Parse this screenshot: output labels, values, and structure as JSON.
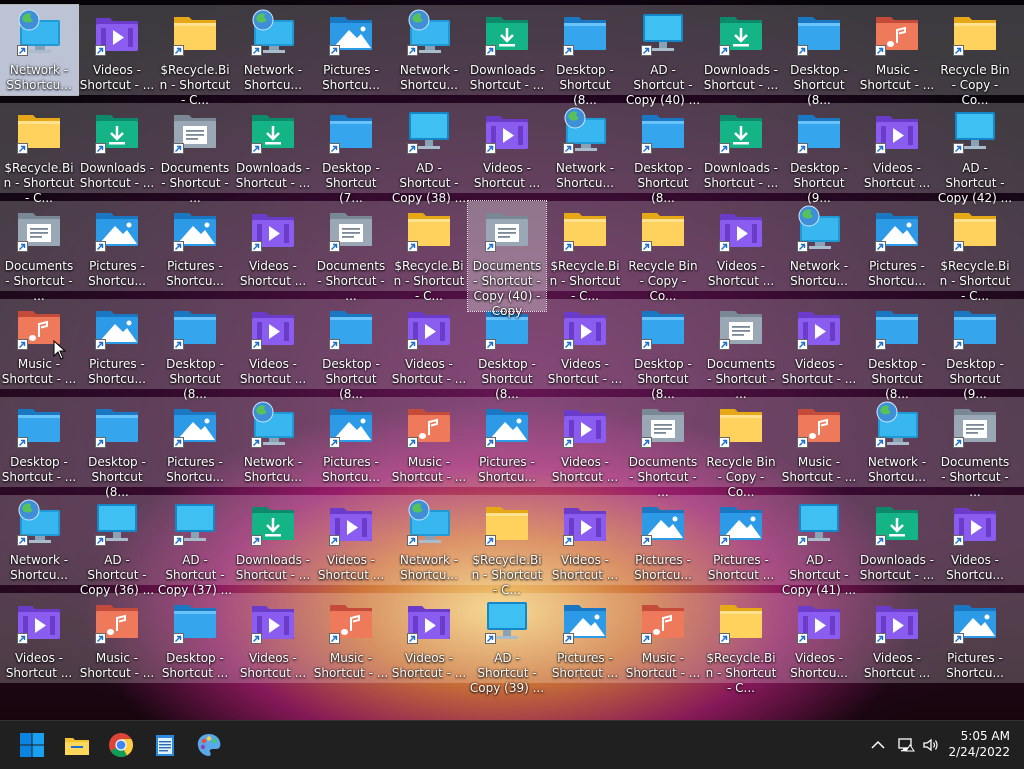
{
  "desktop": {
    "rows": [
      [
        {
          "label": "Network - SShortcu...",
          "icon": "network"
        },
        {
          "label": "Videos - Shortcut - ...",
          "icon": "videos"
        },
        {
          "label": "$Recycle.Bin - Shortcut - C...",
          "icon": "folder"
        },
        {
          "label": "Network - Shortcu...",
          "icon": "network"
        },
        {
          "label": "Pictures - Shortcu...",
          "icon": "pictures"
        },
        {
          "label": "Network - Shortcu...",
          "icon": "network"
        },
        {
          "label": "Downloads - Shortcut - ...",
          "icon": "downloads"
        },
        {
          "label": "Desktop - Shortcut (8...",
          "icon": "desktop"
        },
        {
          "label": "AD - Shortcut - Copy (40) ...",
          "icon": "monitor"
        },
        {
          "label": "Downloads - Shortcut - ...",
          "icon": "downloads"
        },
        {
          "label": "Desktop - Shortcut (8...",
          "icon": "desktop"
        },
        {
          "label": "Music - Shortcut - ...",
          "icon": "music"
        },
        {
          "label": "Recycle Bin - Copy - Co...",
          "icon": "folder"
        }
      ],
      [
        {
          "label": "$Recycle.Bin - Shortcut - C...",
          "icon": "folder"
        },
        {
          "label": "Downloads - Shortcut - ...",
          "icon": "downloads"
        },
        {
          "label": "Documents - Shortcut - ...",
          "icon": "documents"
        },
        {
          "label": "Downloads - Shortcut - ...",
          "icon": "downloads"
        },
        {
          "label": "Desktop - Shortcut (7...",
          "icon": "desktop"
        },
        {
          "label": "AD - Shortcut - Copy (38) ...",
          "icon": "monitor"
        },
        {
          "label": "Videos - Shortcut ...",
          "icon": "videos"
        },
        {
          "label": "Network - Shortcu...",
          "icon": "network"
        },
        {
          "label": "Desktop - Shortcut (8...",
          "icon": "desktop"
        },
        {
          "label": "Downloads - Shortcut - ...",
          "icon": "downloads"
        },
        {
          "label": "Desktop - Shortcut (9...",
          "icon": "desktop"
        },
        {
          "label": "Videos - Shortcut ...",
          "icon": "videos"
        },
        {
          "label": "AD - Shortcut - Copy (42) ...",
          "icon": "monitor"
        }
      ],
      [
        {
          "label": "Documents - Shortcut - ...",
          "icon": "documents"
        },
        {
          "label": "Pictures - Shortcu...",
          "icon": "pictures"
        },
        {
          "label": "Pictures - Shortcu...",
          "icon": "pictures"
        },
        {
          "label": "Videos - Shortcut ...",
          "icon": "videos"
        },
        {
          "label": "Documents - Shortcut - ...",
          "icon": "documents"
        },
        {
          "label": "$Recycle.Bin - Shortcut - C...",
          "icon": "folder"
        },
        {
          "label": "Documents - Shortcut - Copy (40) - Copy",
          "icon": "documents",
          "focused": true
        },
        {
          "label": "$Recycle.Bin - Shortcut - C...",
          "icon": "folder"
        },
        {
          "label": "Recycle Bin - Copy - Co...",
          "icon": "folder"
        },
        {
          "label": "Videos - Shortcut ...",
          "icon": "videos"
        },
        {
          "label": "Network - Shortcu...",
          "icon": "network"
        },
        {
          "label": "Pictures - Shortcu...",
          "icon": "pictures"
        },
        {
          "label": "$Recycle.Bin - Shortcut - C...",
          "icon": "folder"
        }
      ],
      [
        {
          "label": "Music - Shortcut - ...",
          "icon": "music"
        },
        {
          "label": "Pictures - Shortcu...",
          "icon": "pictures"
        },
        {
          "label": "Desktop - Shortcut (8...",
          "icon": "desktop"
        },
        {
          "label": "Videos - Shortcut ...",
          "icon": "videos"
        },
        {
          "label": "Desktop - Shortcut (8...",
          "icon": "desktop"
        },
        {
          "label": "Videos - Shortcut - ...",
          "icon": "videos"
        },
        {
          "label": "Desktop - Shortcut (8...",
          "icon": "desktop"
        },
        {
          "label": "Videos - Shortcut - ...",
          "icon": "videos"
        },
        {
          "label": "Desktop - Shortcut (8...",
          "icon": "desktop"
        },
        {
          "label": "Documents - Shortcut - ...",
          "icon": "documents"
        },
        {
          "label": "Videos - Shortcut - ...",
          "icon": "videos"
        },
        {
          "label": "Desktop - Shortcut (8...",
          "icon": "desktop"
        },
        {
          "label": "Desktop - Shortcut (9...",
          "icon": "desktop"
        }
      ],
      [
        {
          "label": "Desktop - Shortcut - ...",
          "icon": "desktop"
        },
        {
          "label": "Desktop - Shortcut (8...",
          "icon": "desktop"
        },
        {
          "label": "Pictures - Shortcu...",
          "icon": "pictures"
        },
        {
          "label": "Network - Shortcu...",
          "icon": "network"
        },
        {
          "label": "Pictures - Shortcu...",
          "icon": "pictures"
        },
        {
          "label": "Music - Shortcut - ...",
          "icon": "music"
        },
        {
          "label": "Pictures - Shortcu...",
          "icon": "pictures"
        },
        {
          "label": "Videos - Shortcut ...",
          "icon": "videos"
        },
        {
          "label": "Documents - Shortcut - ...",
          "icon": "documents"
        },
        {
          "label": "Recycle Bin - Copy - Co...",
          "icon": "folder"
        },
        {
          "label": "Music - Shortcut - ...",
          "icon": "music"
        },
        {
          "label": "Network - Shortcu...",
          "icon": "network"
        },
        {
          "label": "Documents - Shortcut - ...",
          "icon": "documents"
        }
      ],
      [
        {
          "label": "Network - Shortcu...",
          "icon": "network"
        },
        {
          "label": "AD - Shortcut - Copy (36) ...",
          "icon": "monitor"
        },
        {
          "label": "AD - Shortcut - Copy (37) ...",
          "icon": "monitor"
        },
        {
          "label": "Downloads - Shortcut - ...",
          "icon": "downloads"
        },
        {
          "label": "Videos - Shortcut ...",
          "icon": "videos"
        },
        {
          "label": "Network - Shortcu...",
          "icon": "network"
        },
        {
          "label": "$Recycle.Bin - Shortcut - C...",
          "icon": "folder"
        },
        {
          "label": "Videos - Shortcut ...",
          "icon": "videos"
        },
        {
          "label": "Pictures - Shortcu...",
          "icon": "pictures"
        },
        {
          "label": "Pictures - Shortcut ...",
          "icon": "pictures"
        },
        {
          "label": "AD - Shortcut - Copy (41) ...",
          "icon": "monitor"
        },
        {
          "label": "Downloads - Shortcut - ...",
          "icon": "downloads"
        },
        {
          "label": "Videos - Shortcu...",
          "icon": "videos"
        }
      ],
      [
        {
          "label": "Videos - Shortcut ...",
          "icon": "videos"
        },
        {
          "label": "Music - Shortcut - ...",
          "icon": "music"
        },
        {
          "label": "Desktop - Shortcut ...",
          "icon": "desktop"
        },
        {
          "label": "Videos - Shortcut ...",
          "icon": "videos"
        },
        {
          "label": "Music - Shortcut - ...",
          "icon": "music"
        },
        {
          "label": "Videos - Shortcut - ...",
          "icon": "videos"
        },
        {
          "label": "AD - Shortcut - Copy (39) ...",
          "icon": "monitor"
        },
        {
          "label": "Pictures - Shortcut ...",
          "icon": "pictures"
        },
        {
          "label": "Music - Shortcut - ...",
          "icon": "music"
        },
        {
          "label": "$Recycle.Bin - Shortcut - C...",
          "icon": "folder"
        },
        {
          "label": "Videos - Shortcu...",
          "icon": "videos"
        },
        {
          "label": "Videos - Shortcut ...",
          "icon": "videos"
        },
        {
          "label": "Pictures - Shortcu...",
          "icon": "pictures"
        }
      ]
    ],
    "selected_icon": "Network - SShortcu...",
    "focused_icon": "Documents - Shortcut - Copy (40) - Copy"
  },
  "taskbar": {
    "pinned": [
      {
        "name": "start-button",
        "icon": "windows-logo-icon"
      },
      {
        "name": "file-explorer-button",
        "icon": "folder-icon"
      },
      {
        "name": "chrome-button",
        "icon": "chrome-icon"
      },
      {
        "name": "notepad-button",
        "icon": "notepad-icon"
      },
      {
        "name": "paint-button",
        "icon": "paint-palette-icon"
      }
    ],
    "tray": {
      "icons": [
        "chevron-up-icon",
        "network-icon",
        "volume-icon"
      ],
      "time": "5:05 AM",
      "date": "2/24/2022"
    }
  },
  "colors": {
    "taskbar_bg": "#202020",
    "row_highlight": "rgba(255,255,255,0.22)",
    "accent_blue": "#0078d4"
  }
}
